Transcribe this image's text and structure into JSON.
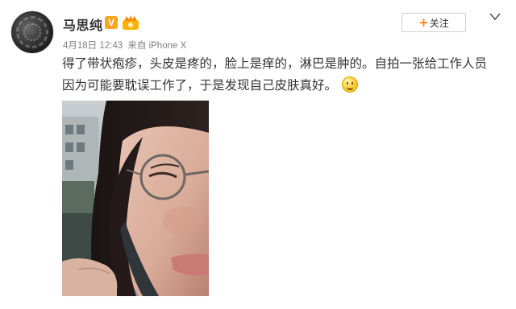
{
  "post": {
    "username": "马思纯",
    "vip_badge": "V",
    "date": "4月18日 12:43",
    "source": "来自 iPhone X",
    "text_line1": "得了带状疱疹，头皮是疼的，脸上是痒的，淋巴是肿的。自拍一张给工作人员",
    "text_line2": "因为可能要耽误工作了，于是发现自己皮肤真好。",
    "follow_plus": "+",
    "follow_label": "关注"
  },
  "icons": {
    "avatar": "avatar-image",
    "vip": "verified-v-icon",
    "member": "member-crown-icon",
    "menu": "chevron-down-icon",
    "emoji": "smile-emoji-icon"
  },
  "colors": {
    "accent": "#ff8200",
    "vip_badge": "#f5a623",
    "meta_text": "#808080",
    "body_text": "#333333"
  }
}
